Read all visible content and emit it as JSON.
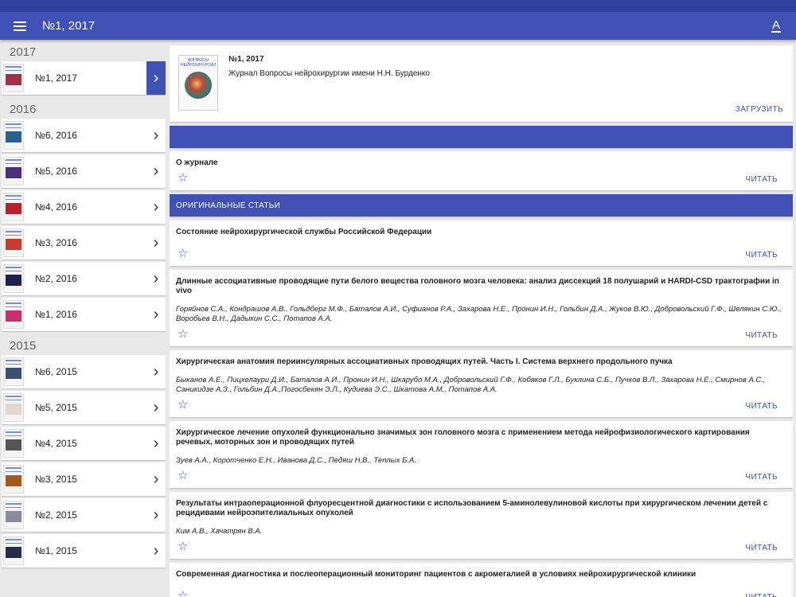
{
  "appbar": {
    "title": "№1, 2017",
    "menu_icon": "menu-icon",
    "font_icon": "text-format-icon",
    "font_glyph": "A"
  },
  "sidebar": {
    "groups": [
      {
        "year": "2017",
        "issues": [
          {
            "label": "№1, 2017",
            "selected": true,
            "thumb_color": "#a3304a"
          }
        ]
      },
      {
        "year": "2016",
        "issues": [
          {
            "label": "№6, 2016",
            "thumb_color": "#2a5f8f"
          },
          {
            "label": "№5, 2016",
            "thumb_color": "#4a2f7a"
          },
          {
            "label": "№4, 2016",
            "thumb_color": "#b8202a"
          },
          {
            "label": "№3, 2016",
            "thumb_color": "#c73a2f"
          },
          {
            "label": "№2, 2016",
            "thumb_color": "#1f1f4f"
          },
          {
            "label": "№1, 2016",
            "thumb_color": "#c7306a"
          }
        ]
      },
      {
        "year": "2015",
        "issues": [
          {
            "label": "№6, 2015",
            "thumb_color": "#3d4f6e"
          },
          {
            "label": "№5, 2015",
            "thumb_color": "#e2d8d0"
          },
          {
            "label": "№4, 2015",
            "thumb_color": "#555555"
          },
          {
            "label": "№3, 2015",
            "thumb_color": "#a05a20"
          },
          {
            "label": "№2, 2015",
            "thumb_color": "#8a8a9a"
          },
          {
            "label": "№1, 2015",
            "thumb_color": "#2a2a4a"
          }
        ]
      }
    ]
  },
  "issue_card": {
    "title": "№1, 2017",
    "journal": "Журнал Вопросы нейрохирургии имени Н.Н. Бурденко",
    "cover_text": "ВОПРОСЫ НЕЙРОХИРУРГИИ",
    "download_label": "ЗАГРУЗИТЬ"
  },
  "about": {
    "title": "О журнале",
    "read_label": "ЧИТАТЬ"
  },
  "section_title": "ОРИГИНАЛЬНЫЕ СТАТЬИ",
  "articles": [
    {
      "title": "Состояние нейрохирургической службы Российской Федерации",
      "authors": "",
      "read_label": "ЧИТАТЬ"
    },
    {
      "title": "Длинные ассоциативные проводящие пути белого вещества головного мозга человека: анализ диссекций 18 полушарий и HARDI-CSD трактографии in vivo",
      "authors": "Горяйнов С.А., Кондрашов А.В., Гольдберг М.Ф., Баталов А.И., Суфианов Р.А., Захарова Н.Е., Пронин И.Н., Гольбин Д.А., Жуков В.Ю., Добровольский Г.Ф., Шелякин С.Ю., Воробьев В.Н., Дадыкин С.С., Потапов А.А.",
      "read_label": "ЧИТАТЬ"
    },
    {
      "title": "Хирургическая анатомия периинсулярных ассоциативных проводящих путей. Часть I. Система верхнего продольного пучка",
      "authors": "Быканов А.Е., Пицхелаури Д.И., Баталов А.И., Пронин И.Н., Шкарубо М.А., Добровольский Г.Ф., Кобяков Г.Л., Буклина С.Б., Пучков В.Л., Захарова Н.Е., Смирнов А.С., Саникидзе А.З., Гольбин Д.А.,Погосбекян Э.Л., Кудиева Э.С., Шкатова А.М., Потапов А.А.",
      "read_label": "ЧИТАТЬ"
    },
    {
      "title": "Хирургическое лечение опухолей функционально значимых зон головного мозга с применением метода нейрофизиологического картирования речевых, моторных зон и проводящих путей",
      "authors": "Зуев А.А., Коротченко Е.Н., Иванова Д.С., Педяш Н.В., Теплых Б.А.",
      "read_label": "ЧИТАТЬ"
    },
    {
      "title": "Результаты интраоперационной флуоресцентной диагностики с использованием 5-аминолевулиновой кислоты при хирургическом лечении детей с рецидивами нейроэпителиальных опухолей",
      "authors": "Ким А.В., Хачатрян В.А.",
      "read_label": "ЧИТАТЬ"
    },
    {
      "title": "Современная диагностика и послеоперационный мониторинг пациентов с акромегалией в условиях нейрохирургической клиники",
      "authors": "",
      "read_label": "ЧИТАТЬ"
    }
  ],
  "colors": {
    "primary": "#3f51b5",
    "primary_dark": "#2f3f9e",
    "background": "#e9e9e9"
  }
}
